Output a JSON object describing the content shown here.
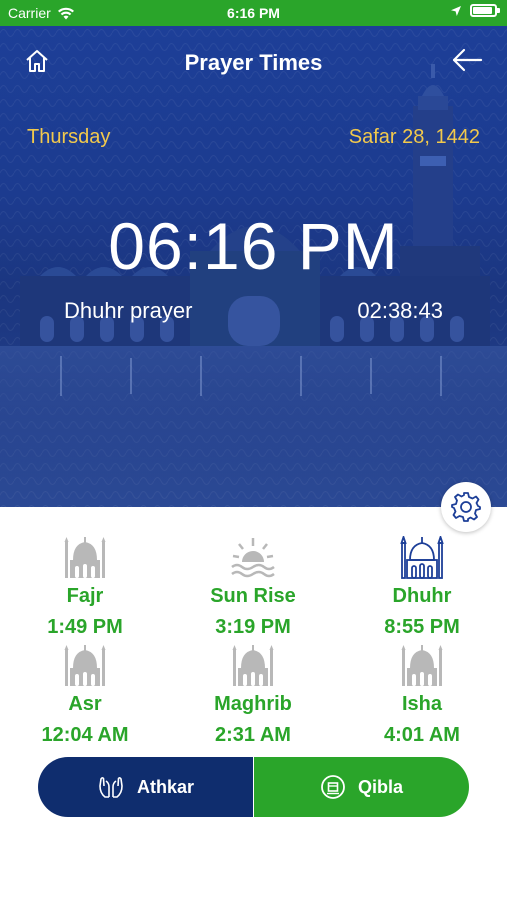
{
  "status_bar": {
    "carrier": "Carrier",
    "time": "6:16 PM",
    "battery_level": 0.9
  },
  "header": {
    "title": "Prayer Times",
    "home_icon": "home-icon",
    "back_icon": "arrow-left-icon"
  },
  "date": {
    "day": "Thursday",
    "hijri": "Safar 28, 1442"
  },
  "clock": {
    "current_time": "06:16 PM",
    "next_prayer_label": "Dhuhr prayer",
    "countdown": "02:38:43"
  },
  "prayers": [
    {
      "name": "Fajr",
      "time": "1:49 PM",
      "icon": "mosque-icon",
      "active": false
    },
    {
      "name": "Sun Rise",
      "time": "3:19 PM",
      "icon": "sunrise-icon",
      "active": false
    },
    {
      "name": "Dhuhr",
      "time": "8:55 PM",
      "icon": "mosque-icon",
      "active": true
    },
    {
      "name": "Asr",
      "time": "12:04 AM",
      "icon": "mosque-icon",
      "active": false
    },
    {
      "name": "Maghrib",
      "time": "2:31 AM",
      "icon": "mosque-icon",
      "active": false
    },
    {
      "name": "Isha",
      "time": "4:01 AM",
      "icon": "mosque-icon",
      "active": false
    }
  ],
  "buttons": {
    "athkar": "Athkar",
    "qibla": "Qibla"
  },
  "colors": {
    "green": "#2aa52a",
    "navy": "#0f2d6e",
    "gold": "#f2c94c",
    "hero": "#1d3f98",
    "icon_gray": "#b8b8b8"
  }
}
